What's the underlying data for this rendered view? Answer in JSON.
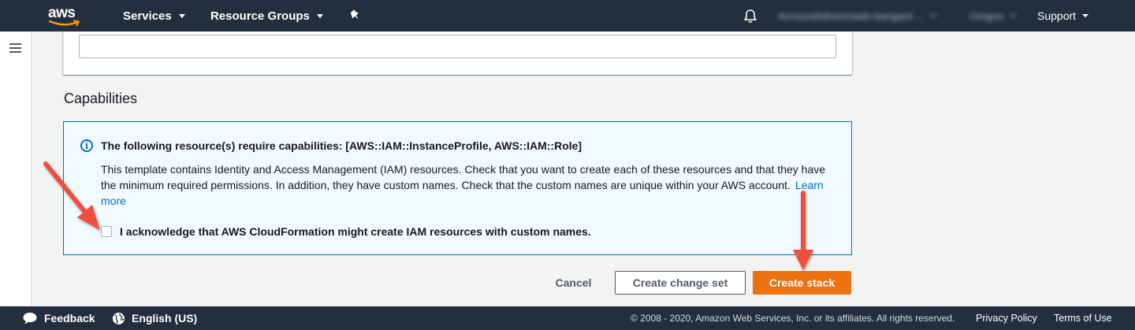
{
  "topnav": {
    "logo_text": "aws",
    "services_label": "Services",
    "resource_groups_label": "Resource Groups",
    "account_label": "AccountAdmin/clado-bangard ...",
    "region_label": "Oregon",
    "support_label": "Support"
  },
  "capabilities": {
    "heading": "Capabilities",
    "alert_title": "The following resource(s) require capabilities: [AWS::IAM::InstanceProfile, AWS::IAM::Role]",
    "alert_body": "This template contains Identity and Access Management (IAM) resources. Check that you want to create each of these resources and that they have the minimum required permissions. In addition, they have custom names. Check that the custom names are unique within your AWS account.",
    "learn_more": "Learn more",
    "acknowledge_label": "I acknowledge that AWS CloudFormation might create IAM resources with custom names.",
    "acknowledge_checked": false
  },
  "actions": {
    "cancel": "Cancel",
    "create_change_set": "Create change set",
    "create_stack": "Create stack"
  },
  "footer": {
    "feedback": "Feedback",
    "language": "English (US)",
    "copyright": "© 2008 - 2020, Amazon Web Services, Inc. or its affiliates. All rights reserved.",
    "privacy_policy": "Privacy Policy",
    "terms_of_use": "Terms of Use"
  },
  "colors": {
    "nav_bg": "#232f3e",
    "primary_button": "#ec7211",
    "info_border": "#0073bb",
    "info_bg": "#f1faff",
    "annotation_arrow": "#f0503c"
  },
  "icons": [
    "aws-logo-icon",
    "pin-icon",
    "bell-icon",
    "hamburger-icon",
    "info-icon",
    "feedback-icon",
    "globe-icon"
  ]
}
